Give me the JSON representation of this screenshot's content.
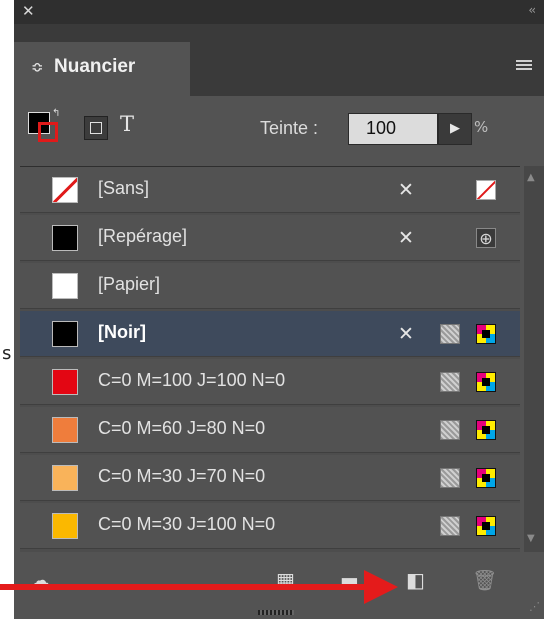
{
  "window": {
    "close_glyph": "✕",
    "collapse_glyph": "‹‹"
  },
  "panel": {
    "title": "Nuancier",
    "tab_chevron": "≎"
  },
  "toolbar": {
    "text_label": "T",
    "tint_label": "Teinte :",
    "tint_value": "100",
    "tint_arrow": "▶",
    "tint_unit": "%"
  },
  "swatches": [
    {
      "name": "[Sans]",
      "chip_color": "#ffffff",
      "icons": [
        "no-edit-icon",
        "none-swatch-icon"
      ]
    },
    {
      "name": "[Repérage]",
      "chip_color": "#000000",
      "icons": [
        "no-edit-icon",
        "registration-icon"
      ]
    },
    {
      "name": "[Papier]",
      "chip_color": "#ffffff",
      "icons": []
    },
    {
      "name": "[Noir]",
      "chip_color": "#000000",
      "selected": true,
      "icons": [
        "no-edit-icon",
        "process-color-icon",
        "cmyk-icon"
      ]
    },
    {
      "name": "C=0 M=100 J=100 N=0",
      "chip_color": "#e30613",
      "icons": [
        "process-color-icon",
        "cmyk-icon"
      ]
    },
    {
      "name": "C=0 M=60 J=80 N=0",
      "chip_color": "#ef7d3c",
      "icons": [
        "process-color-icon",
        "cmyk-icon"
      ]
    },
    {
      "name": "C=0 M=30 J=70 N=0",
      "chip_color": "#f9b35a",
      "icons": [
        "process-color-icon",
        "cmyk-icon"
      ]
    },
    {
      "name": "C=0 M=30 J=100 N=0",
      "chip_color": "#fbb800",
      "icons": [
        "process-color-icon",
        "cmyk-icon"
      ]
    }
  ],
  "outside_text": "s",
  "colors": {
    "panel_bg": "#535353",
    "selected_row": "#3e4a5c",
    "annotation_arrow": "#e41b1b"
  }
}
